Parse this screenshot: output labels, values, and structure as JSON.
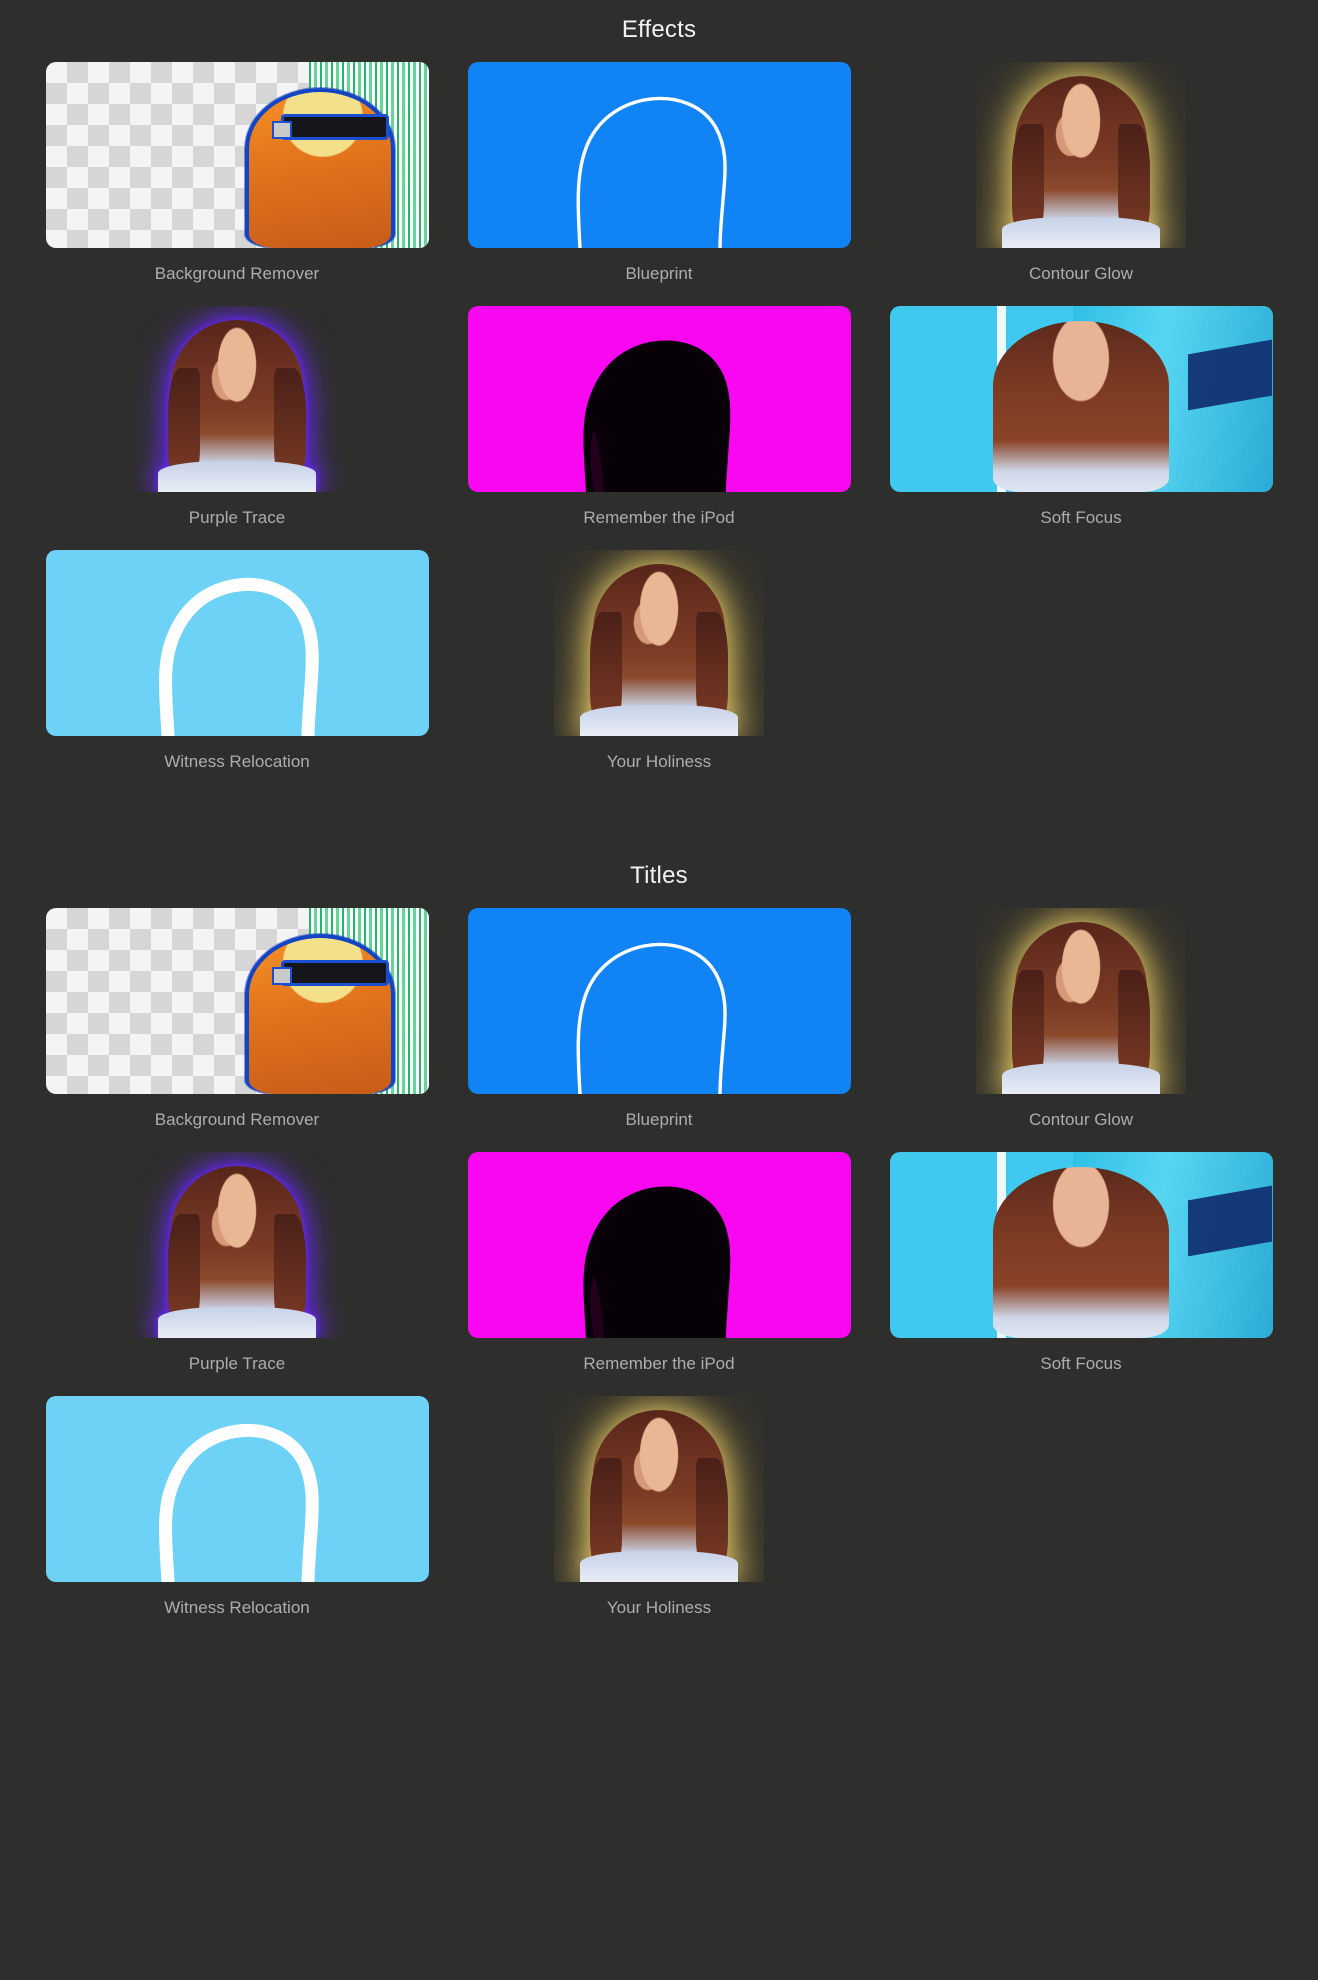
{
  "background_color": "#2e2e2c",
  "label_color": "#adadad",
  "heading_color": "#f2f2f2",
  "accents": {
    "blueprint_blue": "#1184f5",
    "magenta": "#f807f0",
    "soft_focus_cyan": "#3fc9ee",
    "witness_sky": "#6dd2f5",
    "purple_trace": "#6a2ef0",
    "holiness_glow": "#ffe078",
    "cutout_outline": "#1344c4"
  },
  "sections": [
    {
      "id": "effects",
      "heading": "Effects",
      "items": [
        {
          "label": "Background Remover",
          "art": "checker",
          "size": "wide"
        },
        {
          "label": "Blueprint",
          "art": "blueprint",
          "size": "wide"
        },
        {
          "label": "Contour Glow",
          "art": "glow-amber",
          "size": "narrow"
        },
        {
          "label": "Purple Trace",
          "art": "glow-purple",
          "size": "narrow"
        },
        {
          "label": "Remember the iPod",
          "art": "magenta",
          "size": "wide"
        },
        {
          "label": "Soft Focus",
          "art": "softfocus",
          "size": "wide"
        },
        {
          "label": "Witness Relocation",
          "art": "witness",
          "size": "wide"
        },
        {
          "label": "Your Holiness",
          "art": "glow-amber",
          "size": "narrow"
        }
      ]
    },
    {
      "id": "titles",
      "heading": "Titles",
      "items": [
        {
          "label": "Background Remover",
          "art": "checker",
          "size": "wide"
        },
        {
          "label": "Blueprint",
          "art": "blueprint",
          "size": "wide"
        },
        {
          "label": "Contour Glow",
          "art": "glow-amber",
          "size": "narrow"
        },
        {
          "label": "Purple Trace",
          "art": "glow-purple",
          "size": "narrow"
        },
        {
          "label": "Remember the iPod",
          "art": "magenta",
          "size": "wide"
        },
        {
          "label": "Soft Focus",
          "art": "softfocus",
          "size": "wide"
        },
        {
          "label": "Witness Relocation",
          "art": "witness",
          "size": "wide"
        },
        {
          "label": "Your Holiness",
          "art": "glow-amber",
          "size": "narrow"
        }
      ]
    }
  ]
}
